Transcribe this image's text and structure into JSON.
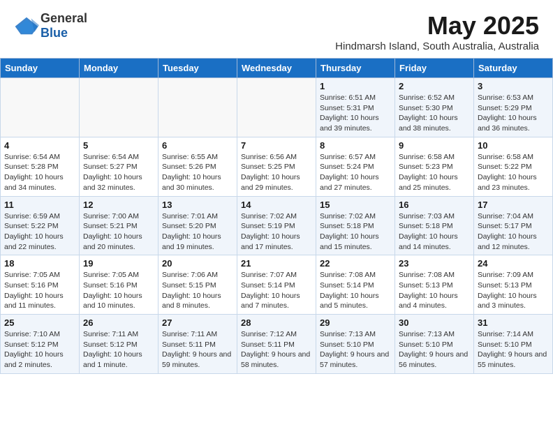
{
  "header": {
    "logo_general": "General",
    "logo_blue": "Blue",
    "month_title": "May 2025",
    "location": "Hindmarsh Island, South Australia, Australia"
  },
  "columns": [
    "Sunday",
    "Monday",
    "Tuesday",
    "Wednesday",
    "Thursday",
    "Friday",
    "Saturday"
  ],
  "weeks": [
    [
      {
        "num": "",
        "info": ""
      },
      {
        "num": "",
        "info": ""
      },
      {
        "num": "",
        "info": ""
      },
      {
        "num": "",
        "info": ""
      },
      {
        "num": "1",
        "info": "Sunrise: 6:51 AM\nSunset: 5:31 PM\nDaylight: 10 hours\nand 39 minutes."
      },
      {
        "num": "2",
        "info": "Sunrise: 6:52 AM\nSunset: 5:30 PM\nDaylight: 10 hours\nand 38 minutes."
      },
      {
        "num": "3",
        "info": "Sunrise: 6:53 AM\nSunset: 5:29 PM\nDaylight: 10 hours\nand 36 minutes."
      }
    ],
    [
      {
        "num": "4",
        "info": "Sunrise: 6:54 AM\nSunset: 5:28 PM\nDaylight: 10 hours\nand 34 minutes."
      },
      {
        "num": "5",
        "info": "Sunrise: 6:54 AM\nSunset: 5:27 PM\nDaylight: 10 hours\nand 32 minutes."
      },
      {
        "num": "6",
        "info": "Sunrise: 6:55 AM\nSunset: 5:26 PM\nDaylight: 10 hours\nand 30 minutes."
      },
      {
        "num": "7",
        "info": "Sunrise: 6:56 AM\nSunset: 5:25 PM\nDaylight: 10 hours\nand 29 minutes."
      },
      {
        "num": "8",
        "info": "Sunrise: 6:57 AM\nSunset: 5:24 PM\nDaylight: 10 hours\nand 27 minutes."
      },
      {
        "num": "9",
        "info": "Sunrise: 6:58 AM\nSunset: 5:23 PM\nDaylight: 10 hours\nand 25 minutes."
      },
      {
        "num": "10",
        "info": "Sunrise: 6:58 AM\nSunset: 5:22 PM\nDaylight: 10 hours\nand 23 minutes."
      }
    ],
    [
      {
        "num": "11",
        "info": "Sunrise: 6:59 AM\nSunset: 5:22 PM\nDaylight: 10 hours\nand 22 minutes."
      },
      {
        "num": "12",
        "info": "Sunrise: 7:00 AM\nSunset: 5:21 PM\nDaylight: 10 hours\nand 20 minutes."
      },
      {
        "num": "13",
        "info": "Sunrise: 7:01 AM\nSunset: 5:20 PM\nDaylight: 10 hours\nand 19 minutes."
      },
      {
        "num": "14",
        "info": "Sunrise: 7:02 AM\nSunset: 5:19 PM\nDaylight: 10 hours\nand 17 minutes."
      },
      {
        "num": "15",
        "info": "Sunrise: 7:02 AM\nSunset: 5:18 PM\nDaylight: 10 hours\nand 15 minutes."
      },
      {
        "num": "16",
        "info": "Sunrise: 7:03 AM\nSunset: 5:18 PM\nDaylight: 10 hours\nand 14 minutes."
      },
      {
        "num": "17",
        "info": "Sunrise: 7:04 AM\nSunset: 5:17 PM\nDaylight: 10 hours\nand 12 minutes."
      }
    ],
    [
      {
        "num": "18",
        "info": "Sunrise: 7:05 AM\nSunset: 5:16 PM\nDaylight: 10 hours\nand 11 minutes."
      },
      {
        "num": "19",
        "info": "Sunrise: 7:05 AM\nSunset: 5:16 PM\nDaylight: 10 hours\nand 10 minutes."
      },
      {
        "num": "20",
        "info": "Sunrise: 7:06 AM\nSunset: 5:15 PM\nDaylight: 10 hours\nand 8 minutes."
      },
      {
        "num": "21",
        "info": "Sunrise: 7:07 AM\nSunset: 5:14 PM\nDaylight: 10 hours\nand 7 minutes."
      },
      {
        "num": "22",
        "info": "Sunrise: 7:08 AM\nSunset: 5:14 PM\nDaylight: 10 hours\nand 5 minutes."
      },
      {
        "num": "23",
        "info": "Sunrise: 7:08 AM\nSunset: 5:13 PM\nDaylight: 10 hours\nand 4 minutes."
      },
      {
        "num": "24",
        "info": "Sunrise: 7:09 AM\nSunset: 5:13 PM\nDaylight: 10 hours\nand 3 minutes."
      }
    ],
    [
      {
        "num": "25",
        "info": "Sunrise: 7:10 AM\nSunset: 5:12 PM\nDaylight: 10 hours\nand 2 minutes."
      },
      {
        "num": "26",
        "info": "Sunrise: 7:11 AM\nSunset: 5:12 PM\nDaylight: 10 hours\nand 1 minute."
      },
      {
        "num": "27",
        "info": "Sunrise: 7:11 AM\nSunset: 5:11 PM\nDaylight: 9 hours\nand 59 minutes."
      },
      {
        "num": "28",
        "info": "Sunrise: 7:12 AM\nSunset: 5:11 PM\nDaylight: 9 hours\nand 58 minutes."
      },
      {
        "num": "29",
        "info": "Sunrise: 7:13 AM\nSunset: 5:10 PM\nDaylight: 9 hours\nand 57 minutes."
      },
      {
        "num": "30",
        "info": "Sunrise: 7:13 AM\nSunset: 5:10 PM\nDaylight: 9 hours\nand 56 minutes."
      },
      {
        "num": "31",
        "info": "Sunrise: 7:14 AM\nSunset: 5:10 PM\nDaylight: 9 hours\nand 55 minutes."
      }
    ]
  ]
}
